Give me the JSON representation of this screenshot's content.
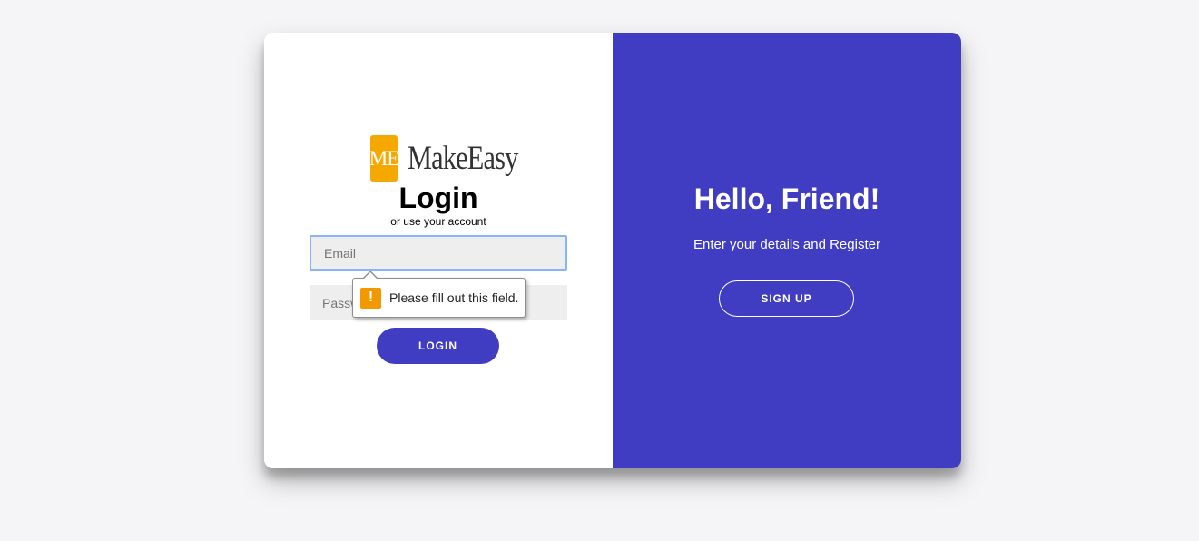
{
  "brand": {
    "logo_mark": "ME",
    "name": "MakeEasy",
    "logo_color": "#f5a800"
  },
  "login": {
    "title": "Login",
    "subtitle": "or use your account",
    "email_placeholder": "Email",
    "password_placeholder": "Password",
    "button_label": "LOGIN"
  },
  "validation": {
    "message": "Please fill out this field.",
    "icon": "warning-icon"
  },
  "register_panel": {
    "title": "Hello, Friend!",
    "description": "Enter your details and Register",
    "button_label": "SIGN UP"
  },
  "colors": {
    "accent": "#403dc3",
    "background": "#f5f5f7"
  }
}
